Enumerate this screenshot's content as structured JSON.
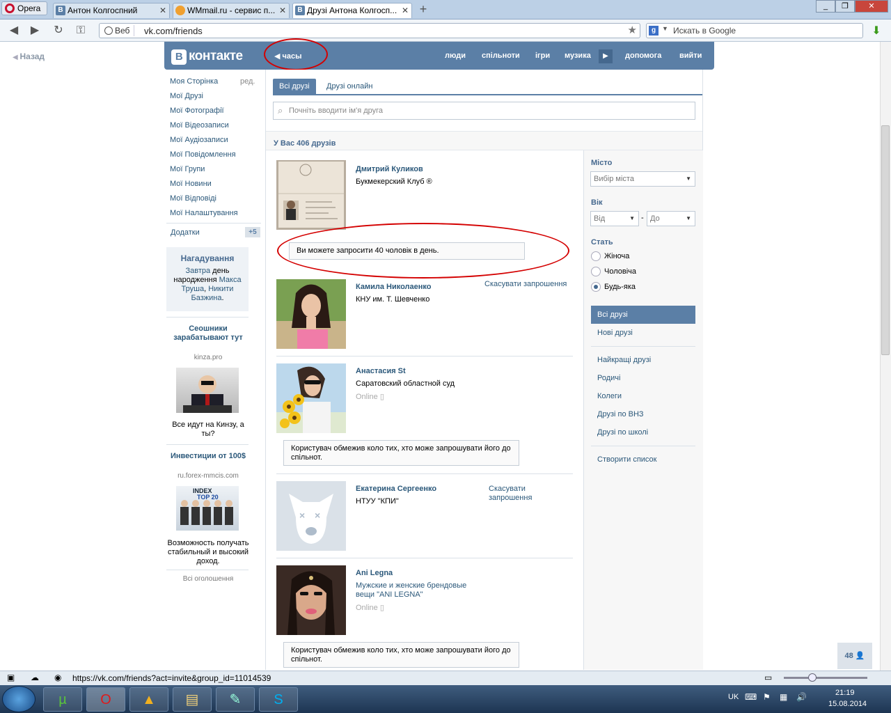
{
  "browser": {
    "opera_label": "Opera",
    "tabs": [
      {
        "label": "Антон Колгосп­ний"
      },
      {
        "label": "WMmail.ru - сервис п..."
      },
      {
        "label": "Друзі Антона Колгосп..."
      }
    ],
    "address_prefix": "Веб",
    "address_url": "vk.com/friends",
    "search_placeholder": "Искать в Google",
    "status_url": "https://vk.com/friends?act=invite&group_id=11014539"
  },
  "page": {
    "back_label": "Назад",
    "logo_letter": "В",
    "logo_text": "контакте",
    "player_label": "часы",
    "nav": [
      "люди",
      "спільноти",
      "ігри",
      "музика",
      "допомога",
      "вийти"
    ]
  },
  "left_menu": {
    "items": [
      "Моя Сторінка",
      "Мої Друзі",
      "Мої Фотографії",
      "Мої Відеозаписи",
      "Мої Аудіозаписи",
      "Мої Повідомлення",
      "Мої Групи",
      "Мої Новини",
      "Мої Відповіді",
      "Мої Налаштування"
    ],
    "edit_label": "ред.",
    "apps_label": "Додатки",
    "apps_badge": "+5",
    "reminder": {
      "title": "Нагадування",
      "link1": "Завтра",
      "text1": " день народження ",
      "link2": "Макса Труша",
      "text2": ", ",
      "link3": "Никити Базжина",
      "text3": "."
    },
    "ads": [
      {
        "title": "Сеошники зарабатывают тут",
        "site": "kinza.pro",
        "text": "Все идут на Кинзу, а ты?"
      },
      {
        "title": "Инвестиции от 100$",
        "site": "ru.forex-mmcis.com",
        "text": "Возможность получать стабильный и высокий доход.",
        "img_text1": "INDEX",
        "img_text2": "TOP 20"
      }
    ],
    "all_ads": "Всі оголошення"
  },
  "content": {
    "tabs": [
      "Всі друзі",
      "Друзі онлайн"
    ],
    "search_placeholder": "Почніть вводити ім'я друга",
    "count_label": "У Вас 406 друзів",
    "friends": [
      {
        "name": "Дмитрий Куликов",
        "sub": "Букмекерский Клуб ®"
      },
      {
        "name": "Камила Николаенко",
        "sub": "КНУ им. Т. Шевченко",
        "action": "Скасувати запрошення"
      },
      {
        "name": "Анастасия St",
        "sub": "Саратовский областной суд",
        "online": "Online"
      },
      {
        "name": "Екатерина Сергеенко",
        "sub": "НТУУ \"КПИ\"",
        "action": "Скасувати запрошення"
      },
      {
        "name": "Ani Legna",
        "sub": "Мужские и женские брендовые вещи \"ANI LEGNA\"",
        "online": "Online"
      }
    ],
    "invite_note": "Ви можете запросити 40 чоловік в день.",
    "restrict_note": "Користувач обмежив коло тих, хто може запрошувати його до спільнот."
  },
  "filters": {
    "city_label": "Місто",
    "city_value": "Вибір міста",
    "age_label": "Вік",
    "age_from": "Від",
    "age_dash": "-",
    "age_to": "До",
    "sex_label": "Стать",
    "sex_options": [
      "Жіноча",
      "Чоловіча",
      "Будь-яка"
    ],
    "lists": [
      "Всі друзі",
      "Нові друзі",
      "Найкращі друзі",
      "Родичі",
      "Колеги",
      "Друзі по ВНЗ",
      "Друзі по школі",
      "Створити список"
    ],
    "online_badge": "48"
  },
  "taskbar": {
    "lang": "UK",
    "time": "21:19",
    "date": "15.08.2014"
  },
  "colors": {
    "vk_blue": "#5b7fa6",
    "link": "#2b587a",
    "red_annotation": "#d40000"
  }
}
